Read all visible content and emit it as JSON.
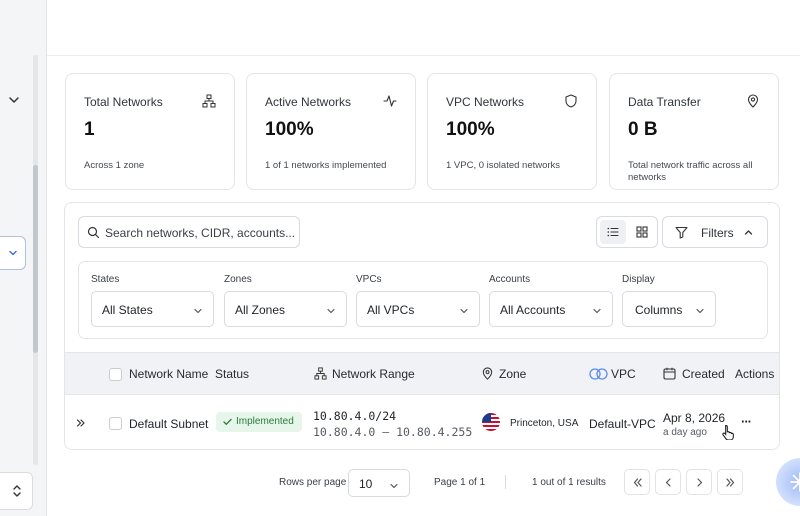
{
  "colors": {
    "accent": "#5b8def",
    "badge_bg": "#e6f6ea",
    "badge_text": "#2a7b3c",
    "border": "#e3e5e9"
  },
  "stats": [
    {
      "title": "Total Networks",
      "icon": "network-icon",
      "value": "1",
      "desc": "Across 1 zone"
    },
    {
      "title": "Active Networks",
      "icon": "activity-icon",
      "value": "100%",
      "desc": "1 of 1 networks implemented"
    },
    {
      "title": "VPC Networks",
      "icon": "shield-icon",
      "value": "100%",
      "desc": "1 VPC, 0 isolated networks"
    },
    {
      "title": "Data Transfer",
      "icon": "map-pin-icon",
      "value": "0 B",
      "desc": "Total network traffic across all networks"
    }
  ],
  "toolbar": {
    "search_placeholder": "Search networks, CIDR, accounts...",
    "filters_label": "Filters"
  },
  "filters": [
    {
      "label": "States",
      "value": "All States"
    },
    {
      "label": "Zones",
      "value": "All Zones"
    },
    {
      "label": "VPCs",
      "value": "All VPCs"
    },
    {
      "label": "Accounts",
      "value": "All Accounts"
    },
    {
      "label": "Display",
      "value": "Columns"
    }
  ],
  "table": {
    "columns": {
      "name": "Network Name",
      "status": "Status",
      "range": "Network Range",
      "zone": "Zone",
      "vpc": "VPC",
      "created": "Created",
      "actions": "Actions"
    },
    "rows": [
      {
        "name": "Default Subnet",
        "status": "Implemented",
        "cidr": "10.80.4.0/24",
        "range": "10.80.4.0 – 10.80.4.255",
        "zone": "Princeton, USA",
        "vpc": "Default-VPC",
        "created_date": "Apr 8, 2026",
        "created_rel": "a day ago",
        "actions": "···"
      }
    ]
  },
  "pagination": {
    "rows_per_page_label": "Rows per page",
    "rows_per_page": "10",
    "page_label": "Page 1 of 1",
    "results_label": "1 out of 1 results"
  }
}
